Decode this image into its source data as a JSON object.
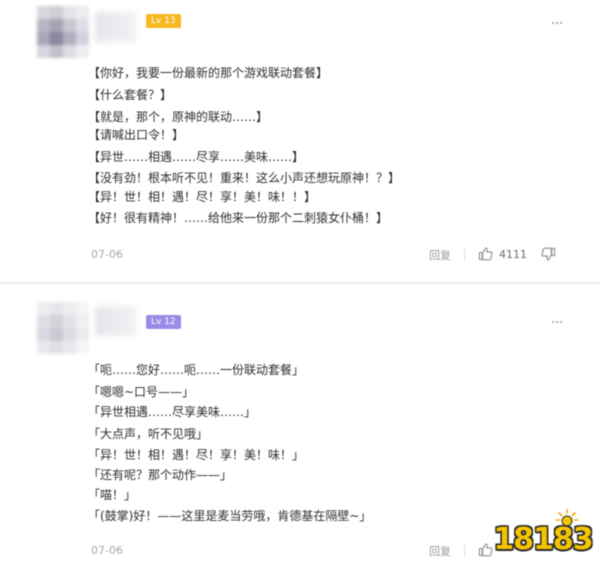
{
  "comments": [
    {
      "level": "Lv 13",
      "level_color": "#f6b81e",
      "lines": [
        "【你好，我要一份最新的那个游戏联动套餐】",
        "【什么套餐？】",
        "【就是，那个，原神的联动……】",
        "【请喊出口令！】",
        "【异世……相遇……尽享……美味……】",
        "【没有劲！根本听不见！重来！这么小声还想玩原神！？】",
        "【异！世！相！遇！尽！享！美！味！！】",
        "【好！很有精神！……给他来一份那个二刺猿女仆桶！】"
      ],
      "date": "07-06",
      "reply_label": "回复",
      "likes": "4111"
    },
    {
      "level": "Lv 12",
      "level_color": "#9b8ae6",
      "lines": [
        "「呃……您好……呃……一份联动套餐」",
        "「嗯嗯~口号——」",
        "「异世相遇……尽享美味……」",
        "「大点声，听不见哦」",
        "「异！世！相！遇！尽！享！美！味！」",
        "「还有呢？那个动作——」",
        "「喵！」",
        "「(鼓掌)好！——这里是麦当劳哦，肯德基在隔壁~」"
      ],
      "date": "07-06",
      "reply_label": "回复",
      "likes": ""
    }
  ],
  "watermark": {
    "text": "18183",
    "color": "#f5c400"
  },
  "icons": {
    "more": "more-dots-icon",
    "like": "thumb-up-icon",
    "dislike": "thumb-down-icon"
  }
}
